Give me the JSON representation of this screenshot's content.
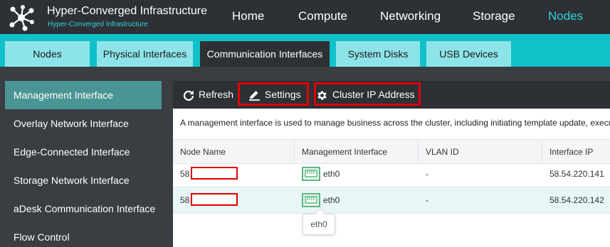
{
  "brand": {
    "title": "Hyper-Converged Infrastructure",
    "subtitle": "Hyper-Converged Infrastructure",
    "logo_icon": "network-nodes-logo"
  },
  "nav": {
    "items": [
      "Home",
      "Compute",
      "Networking",
      "Storage",
      "Nodes"
    ],
    "active": "Nodes"
  },
  "subtabs": {
    "items": [
      "Nodes",
      "Physical Interfaces",
      "Communication Interfaces",
      "System Disks",
      "USB Devices"
    ],
    "active": "Communication Interfaces"
  },
  "sidebar": {
    "items": [
      "Management Interface",
      "Overlay Network Interface",
      "Edge-Connected Interface",
      "Storage Network Interface",
      "aDesk Communication Interface",
      "Flow Control"
    ],
    "active": "Management Interface"
  },
  "toolbar": {
    "refresh": "Refresh",
    "settings": "Settings",
    "cluster_ip": "Cluster IP Address"
  },
  "description": "A management interface is used to manage business across the cluster, including initiating template update, executing",
  "table": {
    "headers": [
      "Node Name",
      "Management Interface",
      "VLAN ID",
      "Interface IP"
    ],
    "rows": [
      {
        "node": "58.",
        "interface": "eth0",
        "vlan": "-",
        "ip": "58.54.220.141"
      },
      {
        "node": "58.",
        "interface": "eth0",
        "vlan": "-",
        "ip": "58.54.220.142"
      }
    ]
  },
  "tooltip": "eth0",
  "colors": {
    "accent": "#2ed3d8",
    "teal_strip": "#10c1c9",
    "highlight": "#e00000",
    "nic_icon": "#3aa56a"
  }
}
